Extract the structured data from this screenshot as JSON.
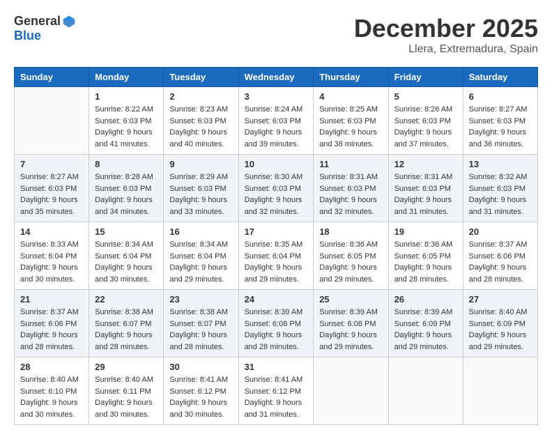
{
  "header": {
    "logo_line1": "General",
    "logo_line2": "Blue",
    "month": "December 2025",
    "location": "Llera, Extremadura, Spain"
  },
  "weekdays": [
    "Sunday",
    "Monday",
    "Tuesday",
    "Wednesday",
    "Thursday",
    "Friday",
    "Saturday"
  ],
  "weeks": [
    [
      {
        "day": "",
        "info": ""
      },
      {
        "day": "1",
        "info": "Sunrise: 8:22 AM\nSunset: 6:03 PM\nDaylight: 9 hours\nand 41 minutes."
      },
      {
        "day": "2",
        "info": "Sunrise: 8:23 AM\nSunset: 6:03 PM\nDaylight: 9 hours\nand 40 minutes."
      },
      {
        "day": "3",
        "info": "Sunrise: 8:24 AM\nSunset: 6:03 PM\nDaylight: 9 hours\nand 39 minutes."
      },
      {
        "day": "4",
        "info": "Sunrise: 8:25 AM\nSunset: 6:03 PM\nDaylight: 9 hours\nand 38 minutes."
      },
      {
        "day": "5",
        "info": "Sunrise: 8:26 AM\nSunset: 6:03 PM\nDaylight: 9 hours\nand 37 minutes."
      },
      {
        "day": "6",
        "info": "Sunrise: 8:27 AM\nSunset: 6:03 PM\nDaylight: 9 hours\nand 36 minutes."
      }
    ],
    [
      {
        "day": "7",
        "info": "Sunrise: 8:27 AM\nSunset: 6:03 PM\nDaylight: 9 hours\nand 35 minutes."
      },
      {
        "day": "8",
        "info": "Sunrise: 8:28 AM\nSunset: 6:03 PM\nDaylight: 9 hours\nand 34 minutes."
      },
      {
        "day": "9",
        "info": "Sunrise: 8:29 AM\nSunset: 6:03 PM\nDaylight: 9 hours\nand 33 minutes."
      },
      {
        "day": "10",
        "info": "Sunrise: 8:30 AM\nSunset: 6:03 PM\nDaylight: 9 hours\nand 32 minutes."
      },
      {
        "day": "11",
        "info": "Sunrise: 8:31 AM\nSunset: 6:03 PM\nDaylight: 9 hours\nand 32 minutes."
      },
      {
        "day": "12",
        "info": "Sunrise: 8:31 AM\nSunset: 6:03 PM\nDaylight: 9 hours\nand 31 minutes."
      },
      {
        "day": "13",
        "info": "Sunrise: 8:32 AM\nSunset: 6:03 PM\nDaylight: 9 hours\nand 31 minutes."
      }
    ],
    [
      {
        "day": "14",
        "info": "Sunrise: 8:33 AM\nSunset: 6:04 PM\nDaylight: 9 hours\nand 30 minutes."
      },
      {
        "day": "15",
        "info": "Sunrise: 8:34 AM\nSunset: 6:04 PM\nDaylight: 9 hours\nand 30 minutes."
      },
      {
        "day": "16",
        "info": "Sunrise: 8:34 AM\nSunset: 6:04 PM\nDaylight: 9 hours\nand 29 minutes."
      },
      {
        "day": "17",
        "info": "Sunrise: 8:35 AM\nSunset: 6:04 PM\nDaylight: 9 hours\nand 29 minutes."
      },
      {
        "day": "18",
        "info": "Sunrise: 8:36 AM\nSunset: 6:05 PM\nDaylight: 9 hours\nand 29 minutes."
      },
      {
        "day": "19",
        "info": "Sunrise: 8:36 AM\nSunset: 6:05 PM\nDaylight: 9 hours\nand 28 minutes."
      },
      {
        "day": "20",
        "info": "Sunrise: 8:37 AM\nSunset: 6:06 PM\nDaylight: 9 hours\nand 28 minutes."
      }
    ],
    [
      {
        "day": "21",
        "info": "Sunrise: 8:37 AM\nSunset: 6:06 PM\nDaylight: 9 hours\nand 28 minutes."
      },
      {
        "day": "22",
        "info": "Sunrise: 8:38 AM\nSunset: 6:07 PM\nDaylight: 9 hours\nand 28 minutes."
      },
      {
        "day": "23",
        "info": "Sunrise: 8:38 AM\nSunset: 6:07 PM\nDaylight: 9 hours\nand 28 minutes."
      },
      {
        "day": "24",
        "info": "Sunrise: 8:39 AM\nSunset: 6:08 PM\nDaylight: 9 hours\nand 28 minutes."
      },
      {
        "day": "25",
        "info": "Sunrise: 8:39 AM\nSunset: 6:08 PM\nDaylight: 9 hours\nand 29 minutes."
      },
      {
        "day": "26",
        "info": "Sunrise: 8:39 AM\nSunset: 6:09 PM\nDaylight: 9 hours\nand 29 minutes."
      },
      {
        "day": "27",
        "info": "Sunrise: 8:40 AM\nSunset: 6:09 PM\nDaylight: 9 hours\nand 29 minutes."
      }
    ],
    [
      {
        "day": "28",
        "info": "Sunrise: 8:40 AM\nSunset: 6:10 PM\nDaylight: 9 hours\nand 30 minutes."
      },
      {
        "day": "29",
        "info": "Sunrise: 8:40 AM\nSunset: 6:11 PM\nDaylight: 9 hours\nand 30 minutes."
      },
      {
        "day": "30",
        "info": "Sunrise: 8:41 AM\nSunset: 6:12 PM\nDaylight: 9 hours\nand 30 minutes."
      },
      {
        "day": "31",
        "info": "Sunrise: 8:41 AM\nSunset: 6:12 PM\nDaylight: 9 hours\nand 31 minutes."
      },
      {
        "day": "",
        "info": ""
      },
      {
        "day": "",
        "info": ""
      },
      {
        "day": "",
        "info": ""
      }
    ]
  ]
}
